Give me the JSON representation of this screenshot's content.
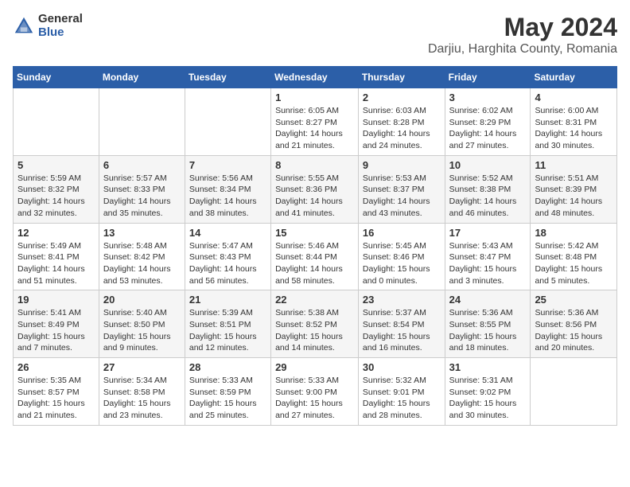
{
  "header": {
    "logo_general": "General",
    "logo_blue": "Blue",
    "month_title": "May 2024",
    "location": "Darjiu, Harghita County, Romania"
  },
  "weekdays": [
    "Sunday",
    "Monday",
    "Tuesday",
    "Wednesday",
    "Thursday",
    "Friday",
    "Saturday"
  ],
  "weeks": [
    [
      {
        "day": "",
        "info": ""
      },
      {
        "day": "",
        "info": ""
      },
      {
        "day": "",
        "info": ""
      },
      {
        "day": "1",
        "info": "Sunrise: 6:05 AM\nSunset: 8:27 PM\nDaylight: 14 hours\nand 21 minutes."
      },
      {
        "day": "2",
        "info": "Sunrise: 6:03 AM\nSunset: 8:28 PM\nDaylight: 14 hours\nand 24 minutes."
      },
      {
        "day": "3",
        "info": "Sunrise: 6:02 AM\nSunset: 8:29 PM\nDaylight: 14 hours\nand 27 minutes."
      },
      {
        "day": "4",
        "info": "Sunrise: 6:00 AM\nSunset: 8:31 PM\nDaylight: 14 hours\nand 30 minutes."
      }
    ],
    [
      {
        "day": "5",
        "info": "Sunrise: 5:59 AM\nSunset: 8:32 PM\nDaylight: 14 hours\nand 32 minutes."
      },
      {
        "day": "6",
        "info": "Sunrise: 5:57 AM\nSunset: 8:33 PM\nDaylight: 14 hours\nand 35 minutes."
      },
      {
        "day": "7",
        "info": "Sunrise: 5:56 AM\nSunset: 8:34 PM\nDaylight: 14 hours\nand 38 minutes."
      },
      {
        "day": "8",
        "info": "Sunrise: 5:55 AM\nSunset: 8:36 PM\nDaylight: 14 hours\nand 41 minutes."
      },
      {
        "day": "9",
        "info": "Sunrise: 5:53 AM\nSunset: 8:37 PM\nDaylight: 14 hours\nand 43 minutes."
      },
      {
        "day": "10",
        "info": "Sunrise: 5:52 AM\nSunset: 8:38 PM\nDaylight: 14 hours\nand 46 minutes."
      },
      {
        "day": "11",
        "info": "Sunrise: 5:51 AM\nSunset: 8:39 PM\nDaylight: 14 hours\nand 48 minutes."
      }
    ],
    [
      {
        "day": "12",
        "info": "Sunrise: 5:49 AM\nSunset: 8:41 PM\nDaylight: 14 hours\nand 51 minutes."
      },
      {
        "day": "13",
        "info": "Sunrise: 5:48 AM\nSunset: 8:42 PM\nDaylight: 14 hours\nand 53 minutes."
      },
      {
        "day": "14",
        "info": "Sunrise: 5:47 AM\nSunset: 8:43 PM\nDaylight: 14 hours\nand 56 minutes."
      },
      {
        "day": "15",
        "info": "Sunrise: 5:46 AM\nSunset: 8:44 PM\nDaylight: 14 hours\nand 58 minutes."
      },
      {
        "day": "16",
        "info": "Sunrise: 5:45 AM\nSunset: 8:46 PM\nDaylight: 15 hours\nand 0 minutes."
      },
      {
        "day": "17",
        "info": "Sunrise: 5:43 AM\nSunset: 8:47 PM\nDaylight: 15 hours\nand 3 minutes."
      },
      {
        "day": "18",
        "info": "Sunrise: 5:42 AM\nSunset: 8:48 PM\nDaylight: 15 hours\nand 5 minutes."
      }
    ],
    [
      {
        "day": "19",
        "info": "Sunrise: 5:41 AM\nSunset: 8:49 PM\nDaylight: 15 hours\nand 7 minutes."
      },
      {
        "day": "20",
        "info": "Sunrise: 5:40 AM\nSunset: 8:50 PM\nDaylight: 15 hours\nand 9 minutes."
      },
      {
        "day": "21",
        "info": "Sunrise: 5:39 AM\nSunset: 8:51 PM\nDaylight: 15 hours\nand 12 minutes."
      },
      {
        "day": "22",
        "info": "Sunrise: 5:38 AM\nSunset: 8:52 PM\nDaylight: 15 hours\nand 14 minutes."
      },
      {
        "day": "23",
        "info": "Sunrise: 5:37 AM\nSunset: 8:54 PM\nDaylight: 15 hours\nand 16 minutes."
      },
      {
        "day": "24",
        "info": "Sunrise: 5:36 AM\nSunset: 8:55 PM\nDaylight: 15 hours\nand 18 minutes."
      },
      {
        "day": "25",
        "info": "Sunrise: 5:36 AM\nSunset: 8:56 PM\nDaylight: 15 hours\nand 20 minutes."
      }
    ],
    [
      {
        "day": "26",
        "info": "Sunrise: 5:35 AM\nSunset: 8:57 PM\nDaylight: 15 hours\nand 21 minutes."
      },
      {
        "day": "27",
        "info": "Sunrise: 5:34 AM\nSunset: 8:58 PM\nDaylight: 15 hours\nand 23 minutes."
      },
      {
        "day": "28",
        "info": "Sunrise: 5:33 AM\nSunset: 8:59 PM\nDaylight: 15 hours\nand 25 minutes."
      },
      {
        "day": "29",
        "info": "Sunrise: 5:33 AM\nSunset: 9:00 PM\nDaylight: 15 hours\nand 27 minutes."
      },
      {
        "day": "30",
        "info": "Sunrise: 5:32 AM\nSunset: 9:01 PM\nDaylight: 15 hours\nand 28 minutes."
      },
      {
        "day": "31",
        "info": "Sunrise: 5:31 AM\nSunset: 9:02 PM\nDaylight: 15 hours\nand 30 minutes."
      },
      {
        "day": "",
        "info": ""
      }
    ]
  ]
}
